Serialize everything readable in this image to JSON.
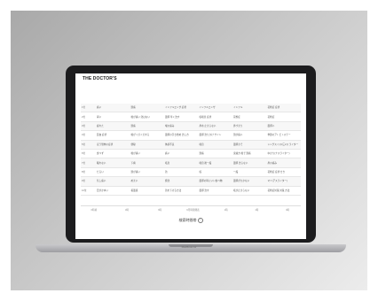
{
  "page": {
    "brand": "THE DOCTOR'S"
  },
  "table": {
    "rows": [
      [
        "1位",
        "痛い",
        "頭痛",
        "インフルエンザ 症状",
        "インフルエンザ",
        "インフル",
        "花粉症 症状"
      ],
      [
        "2位",
        "胃い",
        "喉が痛い 熱はない",
        "風邪 早く治す",
        "咳喘息 症状",
        "花粉症",
        "花粉症"
      ],
      [
        "3位",
        "疲れた",
        "頭痛",
        "喉の痛み",
        "鼻水 止まらない",
        "鼻づまり",
        "風邪い"
      ],
      [
        "4位",
        "貧血 症状",
        "喉がイガイガする",
        "風邪の引き始め 治し方",
        "風邪 治りかけ サイン",
        "頭が痛い",
        "季節のアトピトスチー"
      ],
      [
        "5位",
        "ほう恐怖の症状",
        "便秘",
        "体調不良",
        "喘息",
        "風邪まで",
        "シングスイス3三2ス ライター"
      ],
      [
        "6位",
        "食べず",
        "喉が痛い",
        "痛い",
        "頭痛",
        "鬼滅方 喉で 頭痛",
        "ゆかり(ナスライター)"
      ],
      [
        "7位",
        "眠れない",
        "下痢",
        "咳息",
        "喘息 後一般",
        "風邪 治らない",
        "鼻の痛み"
      ],
      [
        "8位",
        "だるい",
        "頭が痛い",
        "熱",
        "咳",
        "一般",
        "花粉症 症状 せき"
      ],
      [
        "9位",
        "気し痛い",
        "めまい",
        "発熱",
        "風邪の時にいい食べ物",
        "風邪がひかない",
        "マミ(アスライター)"
      ],
      [
        "10位",
        "目がかゆい",
        "着風感",
        "熱を下げる方法",
        "風邪 治す",
        "咳が止まらない",
        "花粉症対策 対策 方法"
      ]
    ]
  },
  "axis": {
    "ticks": [
      "0時頃",
      "3時",
      "6時",
      "9月時間発表",
      "1時",
      "1時",
      "3時"
    ],
    "label": "検索時間帯",
    "info_icon_glyph": "i"
  },
  "device": {
    "model": "MacBook Air"
  }
}
